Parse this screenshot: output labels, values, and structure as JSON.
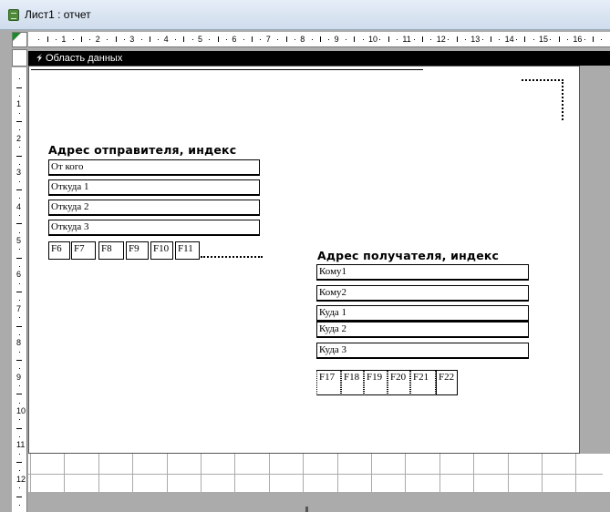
{
  "window": {
    "title": "Лист1 : отчет"
  },
  "section": {
    "label": "Область данных"
  },
  "ruler": {
    "horizontal": [
      "1",
      "2",
      "3",
      "4",
      "5",
      "6",
      "7",
      "8",
      "9",
      "10",
      "11",
      "12",
      "13",
      "14",
      "15",
      "16",
      "1"
    ],
    "vertical": [
      "1",
      "2",
      "3",
      "4",
      "5",
      "6",
      "7",
      "8",
      "9",
      "10",
      "11",
      "12",
      "13"
    ]
  },
  "sender": {
    "heading": "Адрес отправителя, индекс",
    "fields": [
      "От кого",
      "Откуда 1",
      "Откуда 2",
      "Откуда 3"
    ],
    "small_fields": [
      "F6",
      "F7",
      "F8",
      "F9",
      "F10",
      "F11"
    ]
  },
  "recipient": {
    "heading": "Адрес получателя, индекс",
    "fields": [
      "Кому1",
      "Кому2",
      "Куда 1",
      "Куда 2",
      "Куда 3"
    ],
    "small_fields": [
      "F17",
      "F18",
      "F19",
      "F20",
      "F21",
      "F22"
    ]
  },
  "icons": {
    "app": "access-report-icon",
    "section_arrow": "section-arrow-icon",
    "corner": "report-selector-icon"
  }
}
